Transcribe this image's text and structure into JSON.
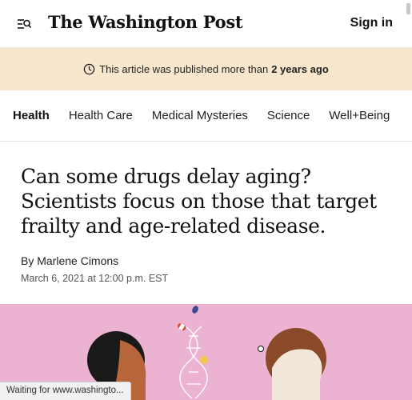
{
  "header": {
    "logo_text": "The Washington Post",
    "signin_label": "Sign in"
  },
  "banner": {
    "text": "This article was published more than",
    "emphasis": "2 years ago"
  },
  "nav": {
    "items": [
      "Health",
      "Health Care",
      "Medical Mysteries",
      "Science",
      "Well+Being"
    ]
  },
  "article": {
    "headline": "Can some drugs delay aging? Scientists focus on those that target frailty and age-related disease.",
    "byline_prefix": "By",
    "author": "Marlene Cimons",
    "date": "March 6, 2021 at 12:00 p.m. EST"
  },
  "status_bar": {
    "text": "Waiting for www.washingto..."
  },
  "colors": {
    "banner_bg": "#f9e7cd",
    "hero_bg": "#ebb3d1"
  }
}
